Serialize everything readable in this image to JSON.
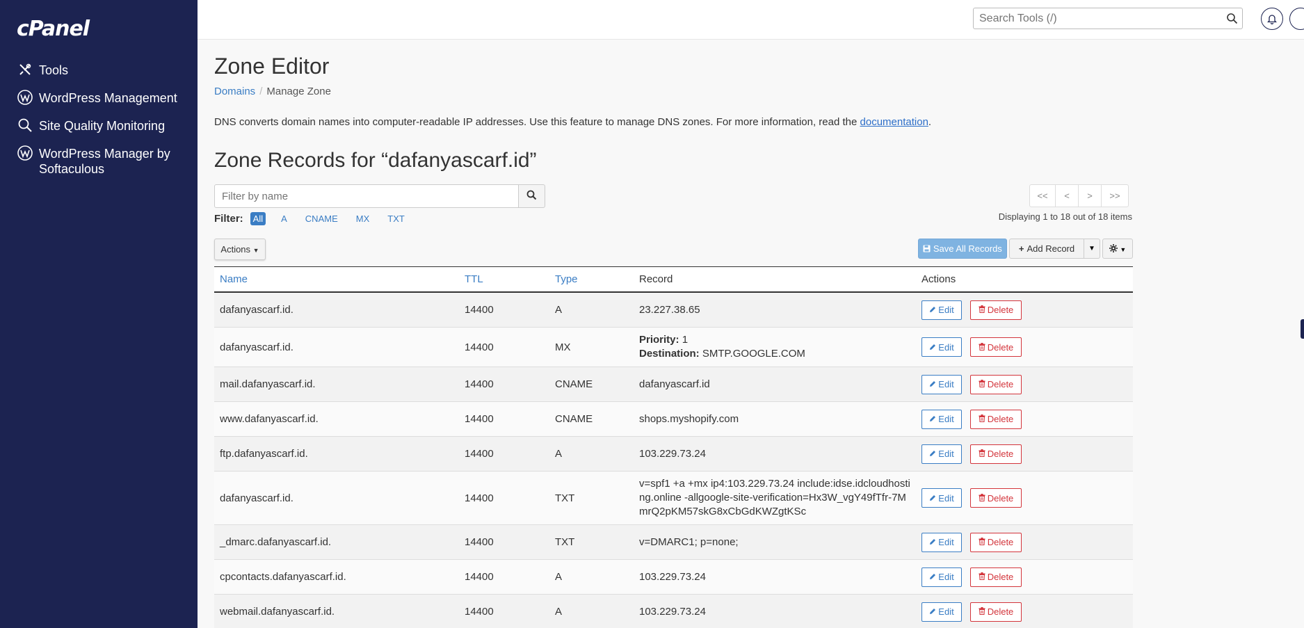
{
  "brand": {
    "logo_text": "cPanel",
    "sidebar_bg": "#1c2351",
    "link_color": "#3a7dc4",
    "danger_color": "#d3343b"
  },
  "sidebar": {
    "items": [
      {
        "label": "Tools",
        "icon": "tools-icon"
      },
      {
        "label": "WordPress Management",
        "icon": "wordpress-icon"
      },
      {
        "label": "Site Quality Monitoring",
        "icon": "magnifier-icon"
      },
      {
        "label": "WordPress Manager by Softaculous",
        "icon": "wordpress-icon"
      }
    ]
  },
  "header": {
    "search_placeholder": "Search Tools (/)"
  },
  "page": {
    "title": "Zone Editor",
    "breadcrumb": {
      "parent": "Domains",
      "separator": "/",
      "current": "Manage Zone"
    },
    "description_pre": "DNS converts domain names into computer-readable IP addresses. Use this feature to manage DNS zones. For more information, read the ",
    "description_link": "documentation",
    "description_post": ".",
    "zone_title": "Zone Records for “dafanyascarf.id”"
  },
  "filter": {
    "placeholder": "Filter by name",
    "label": "Filter:",
    "options": [
      "All",
      "A",
      "CNAME",
      "MX",
      "TXT"
    ],
    "active": "All"
  },
  "pager": {
    "first": "<<",
    "prev": "<",
    "next": ">",
    "last": ">>",
    "displaying": "Displaying 1 to 18 out of 18 items"
  },
  "toolbar": {
    "actions_label": "Actions",
    "save_all_label": "Save All Records",
    "add_record_label": "Add Record"
  },
  "table": {
    "headers": {
      "name": "Name",
      "ttl": "TTL",
      "type": "Type",
      "record": "Record",
      "actions": "Actions"
    },
    "edit_label": "Edit",
    "delete_label": "Delete",
    "rows": [
      {
        "name": "dafanyascarf.id.",
        "ttl": "14400",
        "type": "A",
        "record": "23.227.38.65"
      },
      {
        "name": "dafanyascarf.id.",
        "ttl": "14400",
        "type": "MX",
        "priority_label": "Priority:",
        "priority": "1",
        "destination_label": "Destination:",
        "destination": "SMTP.GOOGLE.COM"
      },
      {
        "name": "mail.dafanyascarf.id.",
        "ttl": "14400",
        "type": "CNAME",
        "record": "dafanyascarf.id"
      },
      {
        "name": "www.dafanyascarf.id.",
        "ttl": "14400",
        "type": "CNAME",
        "record": "shops.myshopify.com"
      },
      {
        "name": "ftp.dafanyascarf.id.",
        "ttl": "14400",
        "type": "A",
        "record": "103.229.73.24"
      },
      {
        "name": "dafanyascarf.id.",
        "ttl": "14400",
        "type": "TXT",
        "record_lines": [
          "v=spf1 +a +mx ip4:103.229.73.24 include:idse.idcloudhosti",
          "ng.online -allgoogle-site-verification=Hx3W_vgY49fTfr-7M",
          "mrQ2pKM57skG8xCbGdKWZgtKSc"
        ]
      },
      {
        "name": "_dmarc.dafanyascarf.id.",
        "ttl": "14400",
        "type": "TXT",
        "record": "v=DMARC1; p=none;"
      },
      {
        "name": "cpcontacts.dafanyascarf.id.",
        "ttl": "14400",
        "type": "A",
        "record": "103.229.73.24"
      },
      {
        "name": "webmail.dafanyascarf.id.",
        "ttl": "14400",
        "type": "A",
        "record": "103.229.73.24"
      }
    ]
  }
}
